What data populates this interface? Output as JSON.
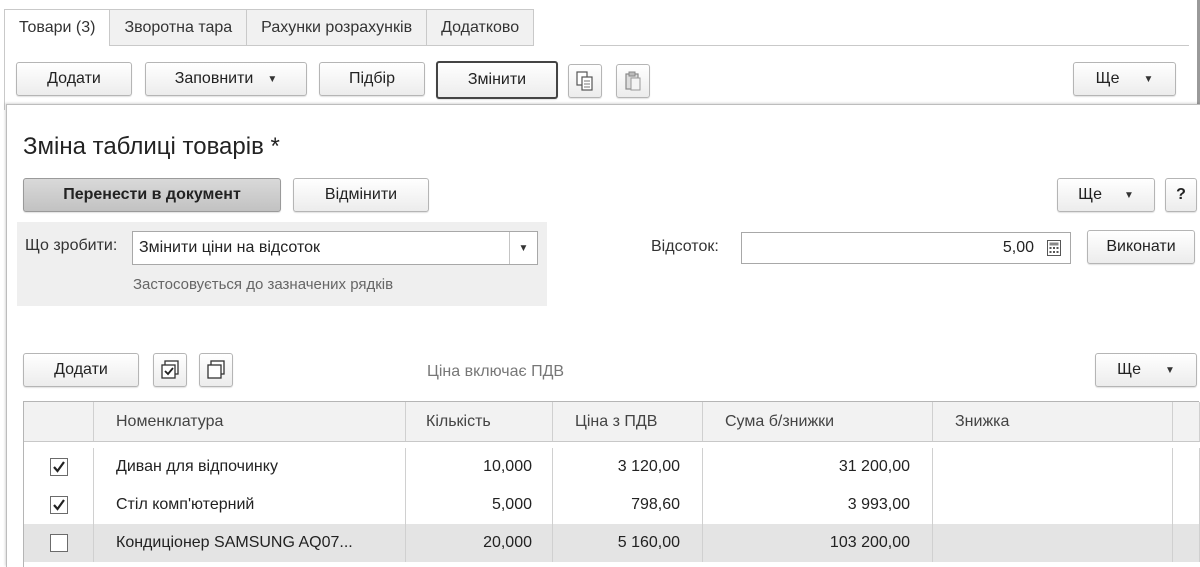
{
  "document": {
    "tabs": [
      {
        "label": "Товари (3)",
        "active": true
      },
      {
        "label": "Зворотна тара",
        "active": false
      },
      {
        "label": "Рахунки розрахунків",
        "active": false
      },
      {
        "label": "Додатково",
        "active": false
      }
    ],
    "toolbar": {
      "add_label": "Додати",
      "fill_label": "Заповнити",
      "pick_label": "Підбір",
      "change_label": "Змінити",
      "more_label": "Ще"
    }
  },
  "dialog": {
    "title": "Зміна таблиці товарів *",
    "transfer_label": "Перенести в документ",
    "cancel_label": "Відмінити",
    "more_label": "Ще",
    "help_label": "?",
    "action": {
      "label": "Що зробити:",
      "value": "Змінити ціни на відсоток",
      "hint": "Застосовується до зазначених рядків"
    },
    "percent": {
      "label": "Відсоток:",
      "value": "5,00"
    },
    "execute_label": "Виконати",
    "table_toolbar": {
      "add_label": "Додати",
      "price_note": "Ціна включає ПДВ",
      "more_label": "Ще"
    },
    "table": {
      "columns": [
        "Номенклатура",
        "Кількість",
        "Ціна з ПДВ",
        "Сума б/знижки",
        "Знижка"
      ],
      "rows": [
        {
          "checked": true,
          "item": "Диван для відпочинку",
          "qty": "10,000",
          "price": "3 120,00",
          "sum": "31 200,00",
          "discount": ""
        },
        {
          "checked": true,
          "item": "Стіл комп'ютерний",
          "qty": "5,000",
          "price": "798,60",
          "sum": "3 993,00",
          "discount": ""
        },
        {
          "checked": false,
          "item": "Кондиціонер SAMSUNG AQ07...",
          "qty": "20,000",
          "price": "5 160,00",
          "sum": "103 200,00",
          "discount": ""
        }
      ]
    }
  },
  "icons": {
    "copy": "copy-icon",
    "paste": "paste-icon",
    "check_all": "check-all-icon",
    "uncheck_all": "uncheck-all-icon",
    "calculator": "calculator-icon",
    "dropdown": "chevron-down-icon"
  }
}
